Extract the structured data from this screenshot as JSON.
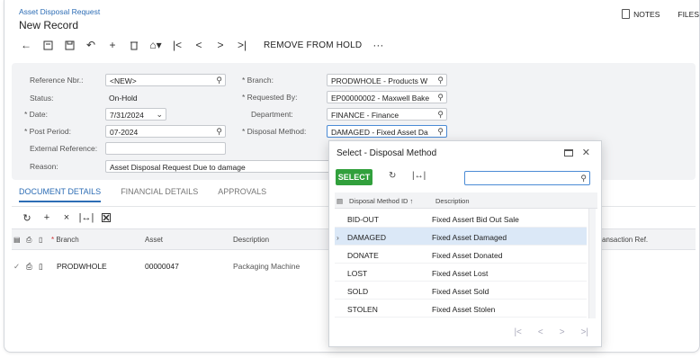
{
  "header": {
    "breadcrumb": "Asset Disposal Request",
    "title": "New Record",
    "notes_label": "NOTES",
    "files_label": "FILES"
  },
  "toolbar": {
    "remove_hold_label": "REMOVE FROM HOLD",
    "more_label": "···"
  },
  "form": {
    "reference_label": "Reference Nbr.:",
    "reference_value": "<NEW>",
    "status_label": "Status:",
    "status_value": "On-Hold",
    "date_label": "Date:",
    "date_value": "7/31/2024",
    "post_period_label": "Post Period:",
    "post_period_value": "07-2024",
    "external_ref_label": "External Reference:",
    "external_ref_value": "",
    "reason_label": "Reason:",
    "reason_value": "Asset Disposal Request Due to damage",
    "branch_label": "Branch:",
    "branch_value": "PRODWHOLE - Products W",
    "requested_by_label": "Requested By:",
    "requested_by_value": "EP00000002 - Maxwell Bake",
    "department_label": "Department:",
    "department_value": "FINANCE - Finance",
    "disposal_method_label": "Disposal Method:",
    "disposal_method_value": "DAMAGED - Fixed Asset Da"
  },
  "tabs": [
    {
      "label": "DOCUMENT DETAILS"
    },
    {
      "label": "FINANCIAL DETAILS"
    },
    {
      "label": "APPROVALS"
    }
  ],
  "grid": {
    "headers": {
      "branch": "Branch",
      "asset": "Asset",
      "description": "Description",
      "transaction_ref": "ansaction Ref."
    },
    "rows": [
      {
        "branch": "PRODWHOLE",
        "asset": "00000047",
        "description": "Packaging Machine"
      }
    ]
  },
  "dialog": {
    "title": "Select - Disposal Method",
    "select_label": "SELECT",
    "search_value": "",
    "col_id": "Disposal Method ID",
    "col_sort": "↑",
    "col_desc": "Description",
    "rows": [
      {
        "id": "BID-OUT",
        "desc": "Fixed Assert Bid Out Sale"
      },
      {
        "id": "DAMAGED",
        "desc": "Fixed Asset Damaged"
      },
      {
        "id": "DONATE",
        "desc": "Fixed Asset Donated"
      },
      {
        "id": "LOST",
        "desc": "Fixed Asset Lost"
      },
      {
        "id": "SOLD",
        "desc": "Fixed Asset Sold"
      },
      {
        "id": "STOLEN",
        "desc": "Fixed Asset Stolen"
      }
    ]
  }
}
